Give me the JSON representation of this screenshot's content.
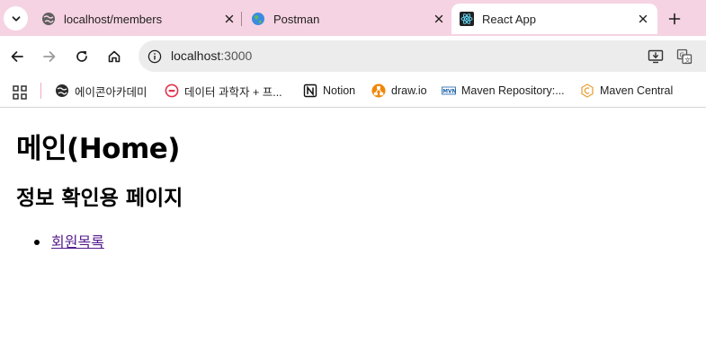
{
  "browser": {
    "tabs": [
      {
        "title": "localhost/members",
        "favicon": "globe-icon",
        "active": false
      },
      {
        "title": "Postman",
        "favicon": "postman-earth-icon",
        "active": false
      },
      {
        "title": "React App",
        "favicon": "react-icon",
        "active": true
      }
    ],
    "address_bar": {
      "host": "localhost",
      "port": ":3000"
    },
    "bookmarks": [
      {
        "label": "에이콘아카데미",
        "icon": "globe-icon"
      },
      {
        "label": "데이터 과학자 + 프...",
        "icon": "red-circle-logo-icon"
      },
      {
        "label": "Notion",
        "icon": "notion-icon"
      },
      {
        "label": "draw.io",
        "icon": "drawio-icon"
      },
      {
        "label": "Maven Repository:...",
        "icon": "mvn-icon"
      },
      {
        "label": "Maven Central",
        "icon": "maven-central-icon"
      }
    ],
    "colors": {
      "tabstrip": "#f6d3e2",
      "active_tab": "#ffffff",
      "omnibox": "#ececec",
      "visited_link": "#551a8b"
    }
  },
  "page": {
    "heading": "메인(Home)",
    "subheading": "정보 확인용 페이지",
    "links": [
      {
        "label": "회원목록"
      }
    ]
  }
}
